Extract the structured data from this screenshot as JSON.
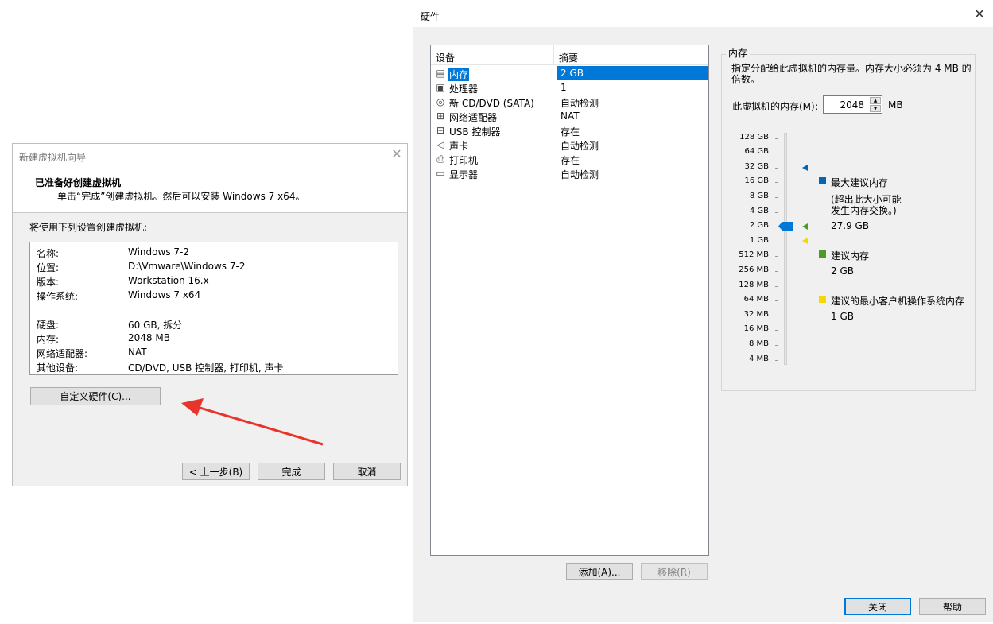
{
  "wizard": {
    "title": "新建虚拟机向导",
    "heading": "已准备好创建虚拟机",
    "subheading": "单击“完成”创建虚拟机。然后可以安装 Windows 7 x64。",
    "intro": "将使用下列设置创建虚拟机:",
    "summary": [
      {
        "key": "名称:",
        "value": "Windows 7-2"
      },
      {
        "key": "位置:",
        "value": "D:\\Vmware\\Windows 7-2"
      },
      {
        "key": "版本:",
        "value": "Workstation 16.x"
      },
      {
        "key": "操作系统:",
        "value": "Windows 7 x64"
      },
      {
        "key": "硬盘:",
        "value": "60 GB, 拆分"
      },
      {
        "key": "内存:",
        "value": "2048 MB"
      },
      {
        "key": "网络适配器:",
        "value": "NAT"
      },
      {
        "key": "其他设备:",
        "value": "CD/DVD, USB 控制器, 打印机, 声卡"
      }
    ],
    "customize_button": "自定义硬件(C)...",
    "back_button": "< 上一步(B)",
    "finish_button": "完成",
    "cancel_button": "取消"
  },
  "hardware": {
    "title": "硬件",
    "columns": {
      "device": "设备",
      "summary": "摘要"
    },
    "devices": [
      {
        "name": "内存",
        "summary": "2 GB",
        "icon": "memory-icon",
        "selected": true
      },
      {
        "name": "处理器",
        "summary": "1",
        "icon": "processor-icon"
      },
      {
        "name": "新 CD/DVD (SATA)",
        "summary": "自动检测",
        "icon": "cd-dvd-icon"
      },
      {
        "name": "网络适配器",
        "summary": "NAT",
        "icon": "network-adapter-icon"
      },
      {
        "name": "USB 控制器",
        "summary": "存在",
        "icon": "usb-icon"
      },
      {
        "name": "声卡",
        "summary": "自动检测",
        "icon": "sound-card-icon"
      },
      {
        "name": "打印机",
        "summary": "存在",
        "icon": "printer-icon"
      },
      {
        "name": "显示器",
        "summary": "自动检测",
        "icon": "display-icon"
      }
    ],
    "add_button": "添加(A)...",
    "remove_button": "移除(R)",
    "close_button": "关闭",
    "help_button": "帮助",
    "memory": {
      "group_title": "内存",
      "description": "指定分配给此虚拟机的内存量。内存大小必须为 4 MB 的倍数。",
      "field_label": "此虚拟机的内存(M):",
      "value": "2048",
      "unit": "MB",
      "scale": [
        "128 GB",
        "64 GB",
        "32 GB",
        "16 GB",
        "8 GB",
        "4 GB",
        "2 GB",
        "1 GB",
        "512 MB",
        "256 MB",
        "128 MB",
        "64 MB",
        "32 MB",
        "16 MB",
        "8 MB",
        "4 MB"
      ],
      "legend": {
        "max_label": "最大建议内存",
        "max_note_1": "(超出此大小可能",
        "max_note_2": "发生内存交换。)",
        "max_value": "27.9 GB",
        "recommended_label": "建议内存",
        "recommended_value": "2 GB",
        "min_label": "建议的最小客户机操作系统内存",
        "min_value": "1 GB"
      },
      "colors": {
        "max": "#0067b8",
        "recommended": "#4c9a2a",
        "min": "#f5d800",
        "thumb": "#0078d7"
      }
    }
  },
  "annotation": {
    "arrow_color": "#e8342a"
  }
}
